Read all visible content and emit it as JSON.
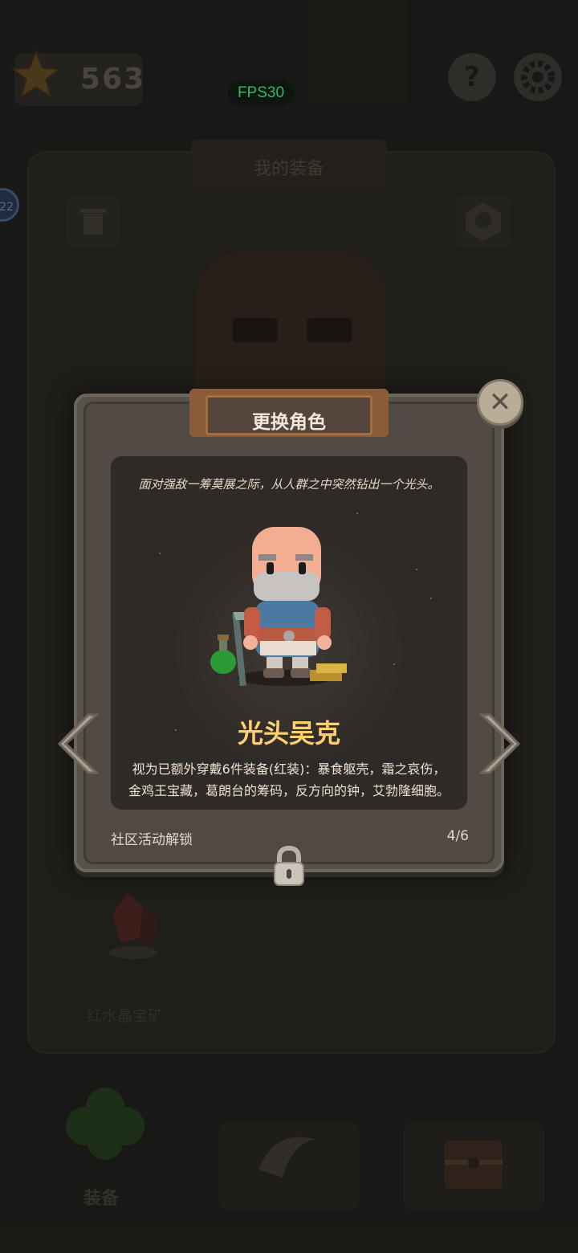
{
  "hud": {
    "score": "563",
    "fps": "FPS30",
    "side_badge": "22"
  },
  "background": {
    "panel_title": "我的装备",
    "mine_label": "红水晶宝矿",
    "equip_tab_label": "装备"
  },
  "dialog": {
    "title": "更换角色",
    "description": "面对强敌一筹莫展之际，从人群之中突然钻出一个光头。",
    "character_name": "光头吴克",
    "ability_line1": "视为已额外穿戴6件装备(红装)：暴食躯壳，霜之哀伤，",
    "ability_line2": "金鸡王宝藏，葛朗台的筹码，反方向的钟，艾勃隆细胞。",
    "unlock_method": "社区活动解锁",
    "page_indicator": "4/6"
  },
  "icons": [
    "star-icon",
    "help-icon",
    "gear-icon",
    "close-icon",
    "arrow-left-icon",
    "arrow-right-icon",
    "lock-icon",
    "trash-icon",
    "team-icon",
    "clover-icon",
    "crystal-icon",
    "pickaxe-icon",
    "chest-icon"
  ],
  "colors": {
    "character_name": "#ffcf70",
    "fps_text": "#3fe07a",
    "dialog_bg": "#514a44",
    "banner_border": "#a4703f"
  }
}
